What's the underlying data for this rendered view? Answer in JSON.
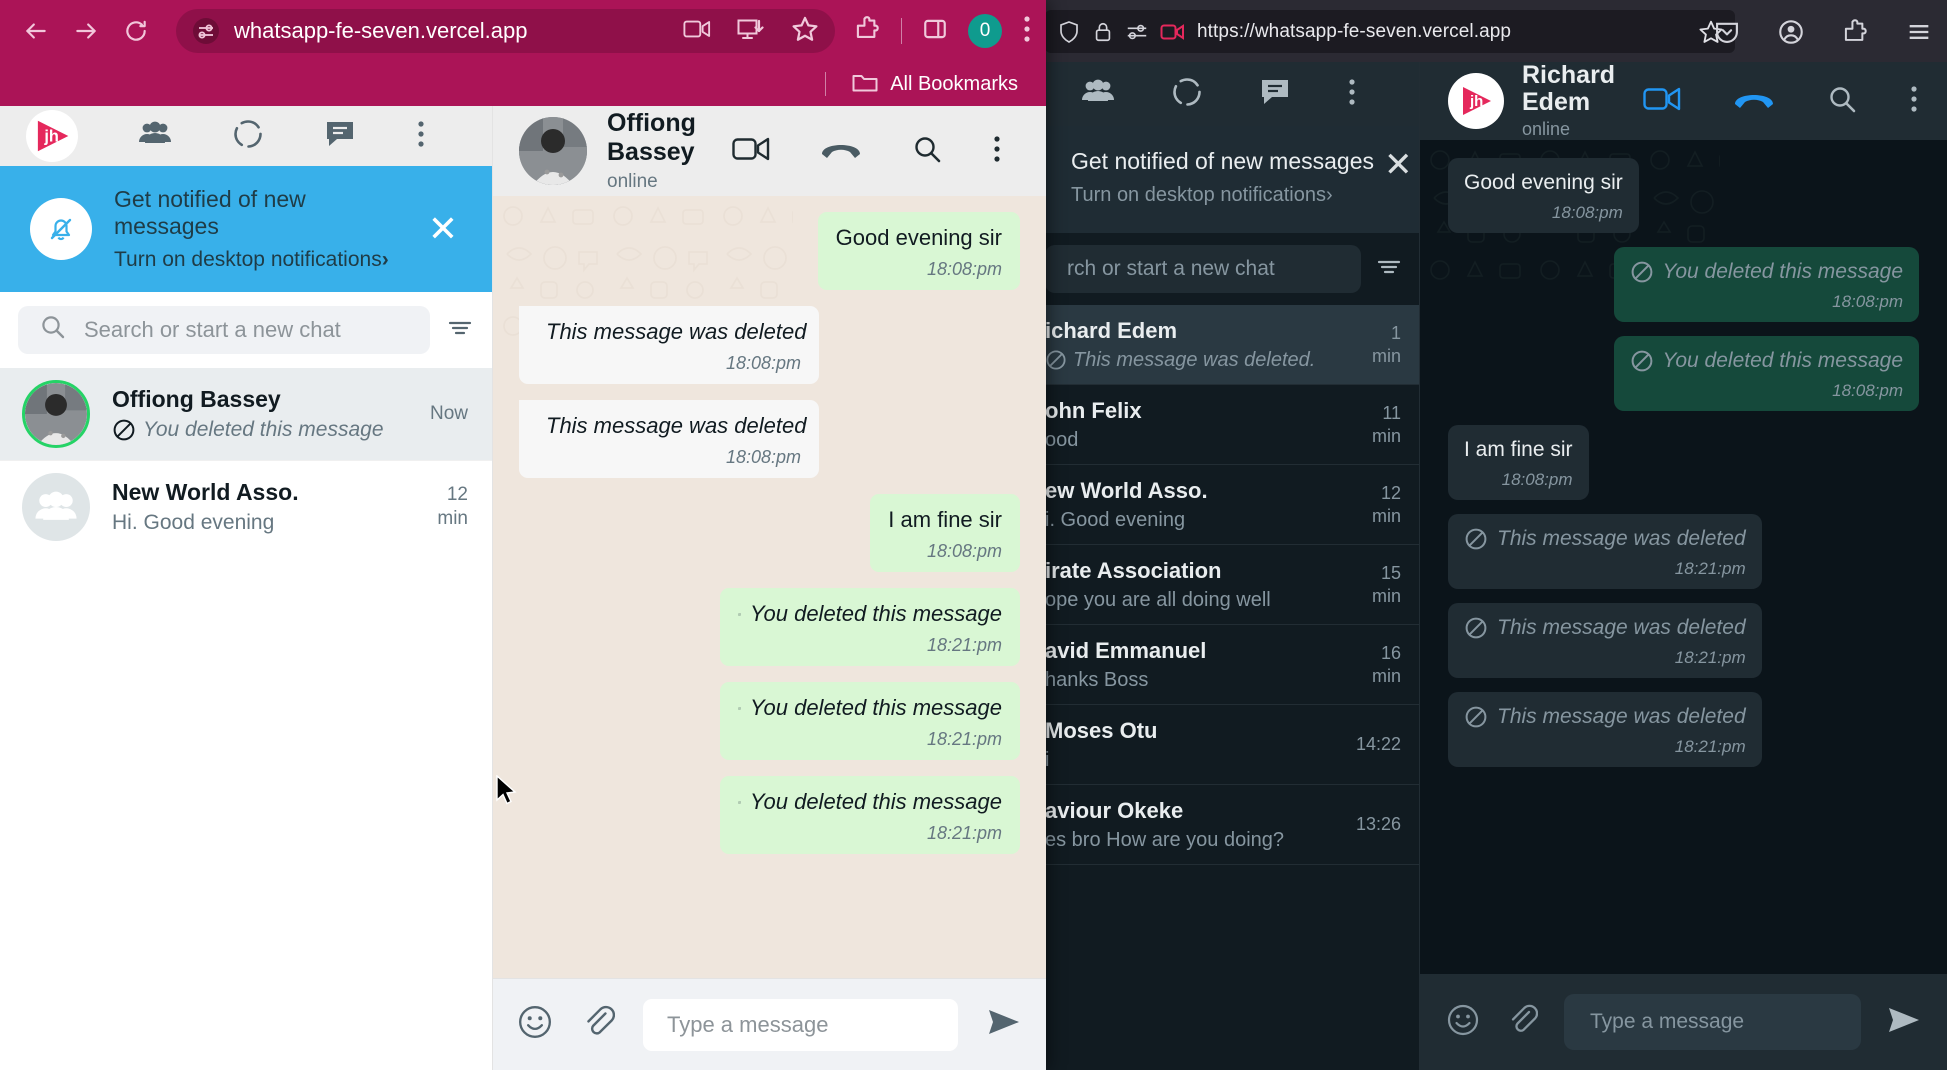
{
  "chrome": {
    "url": "whatsapp-fe-seven.vercel.app",
    "profile_badge": "0",
    "bookmarks_label": "All Bookmarks",
    "icons": {
      "back": "back-arrow-icon",
      "forward": "forward-arrow-icon",
      "reload": "reload-icon",
      "site_info": "site-settings-icon",
      "cast": "video-camera-icon",
      "install": "install-app-icon",
      "bookmark": "star-icon",
      "extensions": "extensions-puzzle-icon",
      "sidepanel": "side-panel-icon",
      "menu": "three-dot-menu-icon",
      "folder": "folder-icon"
    }
  },
  "firefox": {
    "url": "https://whatsapp-fe-seven.vercel.app",
    "icons": {
      "shield": "shield-icon",
      "lock": "padlock-icon",
      "permissions": "site-permissions-icon",
      "camera": "camera-permission-icon",
      "bookmark": "star-icon",
      "pocket": "pocket-save-icon",
      "account": "account-circle-icon",
      "extensions": "extensions-puzzle-icon",
      "menu": "hamburger-menu-icon"
    }
  },
  "whatsapp_light": {
    "logo_text": "jh",
    "header_icons": [
      "community-people-icon",
      "status-circle-icon",
      "new-chat-icon",
      "three-dot-menu-icon"
    ],
    "notification": {
      "title": "Get notified of new messages",
      "subtitle": "Turn on desktop notifications",
      "chevron": "›",
      "close": "✕"
    },
    "search": {
      "placeholder": "Search or start a new chat",
      "icon": "search-icon",
      "filter_icon": "filter-icon"
    },
    "chats": [
      {
        "name": "Offiong Bassey",
        "preview": "You deleted this message",
        "deleted": true,
        "time": "Now",
        "active": true,
        "avatar": "photo"
      },
      {
        "name": "New World Asso.",
        "preview": "Hi. Good evening",
        "deleted": false,
        "time": "12 min",
        "active": false,
        "avatar": "group"
      }
    ],
    "chat_header": {
      "name_line1": "Offiong",
      "name_line2": "Bassey",
      "status": "online",
      "icons": [
        "video-call-icon",
        "voice-call-icon",
        "search-icon",
        "three-dot-menu-icon"
      ]
    },
    "messages": [
      {
        "dir": "out",
        "text": "Good evening sir",
        "time": "18:08:pm",
        "deleted": false
      },
      {
        "dir": "in",
        "text": "This message was deleted",
        "time": "18:08:pm",
        "deleted": true
      },
      {
        "dir": "in",
        "text": "This message was deleted",
        "time": "18:08:pm",
        "deleted": true
      },
      {
        "dir": "out",
        "text": "I am fine sir",
        "time": "18:08:pm",
        "deleted": false
      },
      {
        "dir": "out",
        "text": "You deleted this message",
        "time": "18:21:pm",
        "deleted": true
      },
      {
        "dir": "out",
        "text": "You deleted this message",
        "time": "18:21:pm",
        "deleted": true
      },
      {
        "dir": "out",
        "text": "You deleted this message",
        "time": "18:21:pm",
        "deleted": true
      }
    ],
    "composer": {
      "placeholder": "Type a message",
      "emoji_icon": "emoji-smiley-icon",
      "attach_icon": "paperclip-icon",
      "send_icon": "send-icon"
    }
  },
  "whatsapp_dark": {
    "logo_text": "jh",
    "header_icons": [
      "community-people-icon",
      "status-circle-icon",
      "new-chat-icon",
      "three-dot-menu-icon"
    ],
    "notification": {
      "title": "Get notified of new messages",
      "subtitle": "Turn on desktop notifications",
      "chevron": "›",
      "close": "✕"
    },
    "search": {
      "placeholder": "rch or start a new chat",
      "filter_icon": "filter-icon"
    },
    "chats": [
      {
        "name": "ichard Edem",
        "preview": "This message was deleted.",
        "deleted": true,
        "time": "1 min",
        "active": true
      },
      {
        "name": "ohn Felix",
        "preview": "ood",
        "deleted": false,
        "time": "11 min",
        "active": false
      },
      {
        "name": "ew World Asso.",
        "preview": "i. Good evening",
        "deleted": false,
        "time": "12 min",
        "active": false
      },
      {
        "name": "irate Association",
        "preview": "ope you are all doing well",
        "deleted": false,
        "time": "15 min",
        "active": false
      },
      {
        "name": "avid Emmanuel",
        "preview": "hanks Boss",
        "deleted": false,
        "time": "16 min",
        "active": false
      },
      {
        "name": "Moses Otu",
        "preview": "i",
        "deleted": false,
        "time": "14:22",
        "active": false
      },
      {
        "name": "aviour Okeke",
        "preview": "es bro How are you doing?",
        "deleted": false,
        "time": "13:26",
        "active": false
      }
    ],
    "chat_header": {
      "name_line1": "Richard",
      "name_line2": "Edem",
      "status": "online",
      "icons": [
        "video-call-icon",
        "voice-call-icon",
        "search-icon",
        "three-dot-menu-icon"
      ]
    },
    "messages": [
      {
        "dir": "in",
        "text": "Good evening sir",
        "time": "18:08:pm",
        "deleted": false
      },
      {
        "dir": "out",
        "text": "You deleted this message",
        "time": "18:08:pm",
        "deleted": true
      },
      {
        "dir": "out",
        "text": "You deleted this message",
        "time": "18:08:pm",
        "deleted": true
      },
      {
        "dir": "in",
        "text": "I am fine sir",
        "time": "18:08:pm",
        "deleted": false
      },
      {
        "dir": "in",
        "text": "This message was deleted",
        "time": "18:21:pm",
        "deleted": true
      },
      {
        "dir": "in",
        "text": "This message was deleted",
        "time": "18:21:pm",
        "deleted": true
      },
      {
        "dir": "in",
        "text": "This message was deleted",
        "time": "18:21:pm",
        "deleted": true
      }
    ],
    "composer": {
      "placeholder": "Type a message",
      "emoji_icon": "emoji-smiley-icon",
      "attach_icon": "paperclip-icon",
      "send_icon": "send-icon"
    }
  },
  "colors": {
    "chrome_theme": "#ab1457",
    "notification_blue": "#38b0ea",
    "bubble_out_light": "#d9f7d4",
    "bubble_out_dark": "#15493b",
    "bubble_in_dark": "#202c33",
    "accent_blue": "#2196f3",
    "logo_pink": "#e5285c",
    "online_ring": "#25d366"
  }
}
